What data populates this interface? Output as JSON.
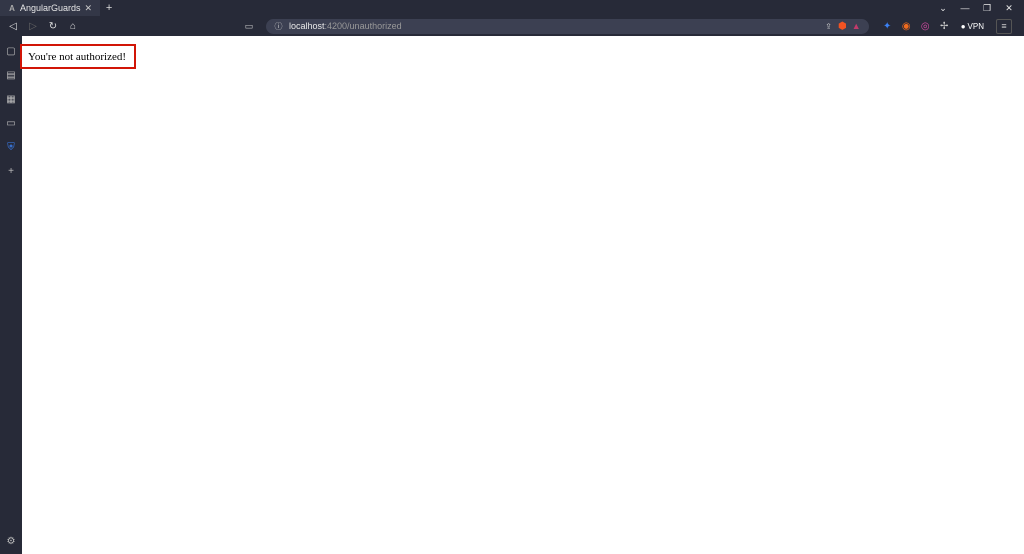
{
  "window": {
    "chevron": "⌄",
    "minimize": "—",
    "maximize": "❐",
    "close": "✕"
  },
  "tab": {
    "favicon_letter": "A",
    "title": "AngularGuards",
    "close_glyph": "✕"
  },
  "newtab_glyph": "+",
  "nav": {
    "back_glyph": "◁",
    "forward_glyph": "▷",
    "reload_glyph": "↻",
    "home_glyph": "⌂"
  },
  "bookmark_glyph": "▭",
  "url": {
    "info_glyph": "ⓘ",
    "host": "localhost",
    "port_path": ":4200/unauthorized",
    "share_glyph": "⇪"
  },
  "shields": {
    "brave_glyph": "⬢",
    "brave_color": "#f25322",
    "rewards_glyph": "▲",
    "rewards_color": "#c23a6b"
  },
  "extensions": {
    "ext1_glyph": "✦",
    "ext1_color": "#3b82f6",
    "ext2_glyph": "◉",
    "ext2_color": "#f26b1d",
    "ext3_glyph": "◎",
    "ext3_color": "#d64ca4",
    "puzzle_glyph": "✢",
    "vpn_dot": "●",
    "vpn_label": "VPN"
  },
  "menu_glyph": "≡",
  "sidebar": {
    "item1_glyph": "▢",
    "item2_glyph": "▤",
    "item3_glyph": "▦",
    "item4_glyph": "▭",
    "shield_glyph": "⛨",
    "add_glyph": "+",
    "settings_glyph": "⚙"
  },
  "page": {
    "message": "You're not authorized!"
  }
}
